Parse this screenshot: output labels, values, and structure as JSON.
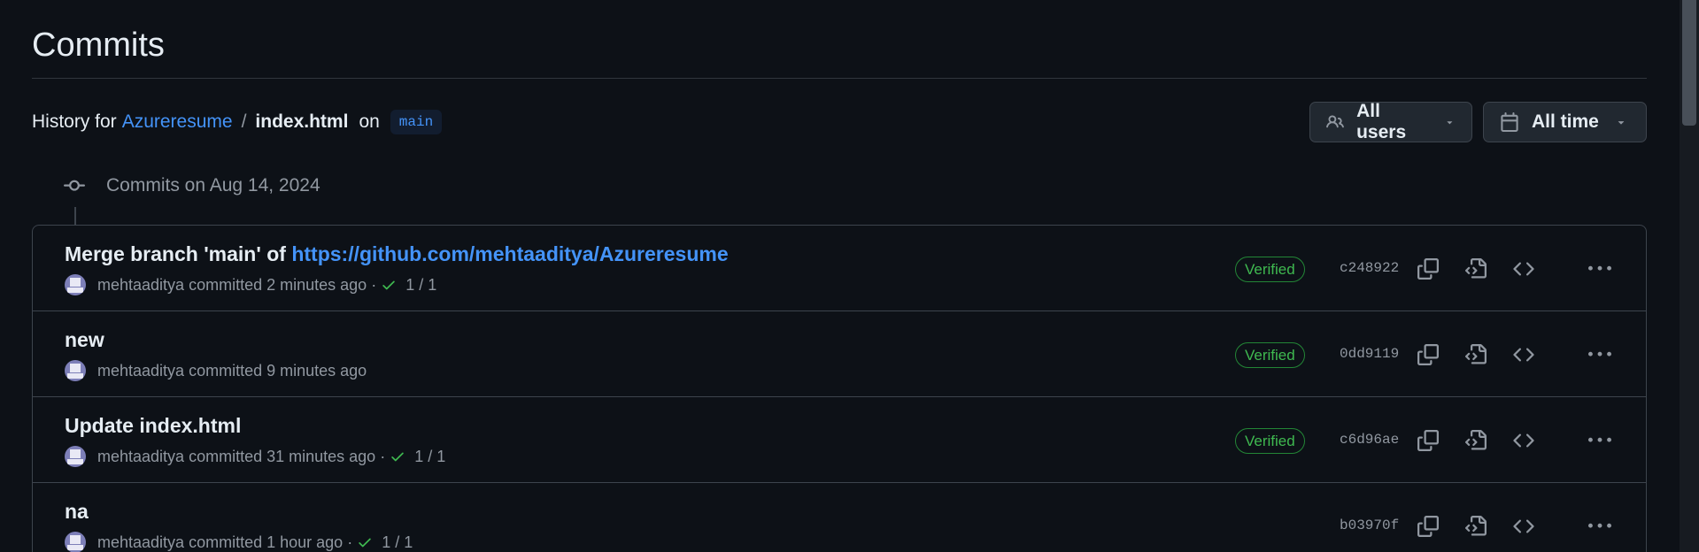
{
  "page_title": "Commits",
  "history": {
    "label": "History for",
    "repo": "Azureresume",
    "separator": "/",
    "file": "index.html",
    "on": "on",
    "branch": "main"
  },
  "filters": {
    "users_label": "All users",
    "time_label": "All time"
  },
  "group_header": "Commits on Aug 14, 2024",
  "commits": [
    {
      "message_prefix": "Merge branch 'main' of",
      "message_link": "https://github.com/mehtaaditya/Azureresume",
      "author": "mehtaaditya",
      "action": "committed",
      "time": "2 minutes ago",
      "checks": "1 / 1",
      "verified": "Verified",
      "sha": "c248922"
    },
    {
      "message_prefix": "new",
      "message_link": "",
      "author": "mehtaaditya",
      "action": "committed",
      "time": "9 minutes ago",
      "checks": "",
      "verified": "Verified",
      "sha": "0dd9119"
    },
    {
      "message_prefix": "Update index.html",
      "message_link": "",
      "author": "mehtaaditya",
      "action": "committed",
      "time": "31 minutes ago",
      "checks": "1 / 1",
      "verified": "Verified",
      "sha": "c6d96ae"
    },
    {
      "message_prefix": "na",
      "message_link": "",
      "author": "mehtaaditya",
      "action": "committed",
      "time": "1 hour ago",
      "checks": "1 / 1",
      "verified": "",
      "sha": "b03970f"
    }
  ],
  "icons": {
    "users": "people-icon",
    "time": "calendar-icon",
    "group": "git-commit-icon",
    "check": "check-icon",
    "copy": "copy-icon",
    "browse_file": "file-code-icon",
    "browse_repo": "code-icon",
    "more": "kebab-horizontal-icon"
  },
  "colors": {
    "background": "#0d1117",
    "accent": "#4493f8",
    "success": "#3fb950",
    "muted": "#9198a1"
  }
}
